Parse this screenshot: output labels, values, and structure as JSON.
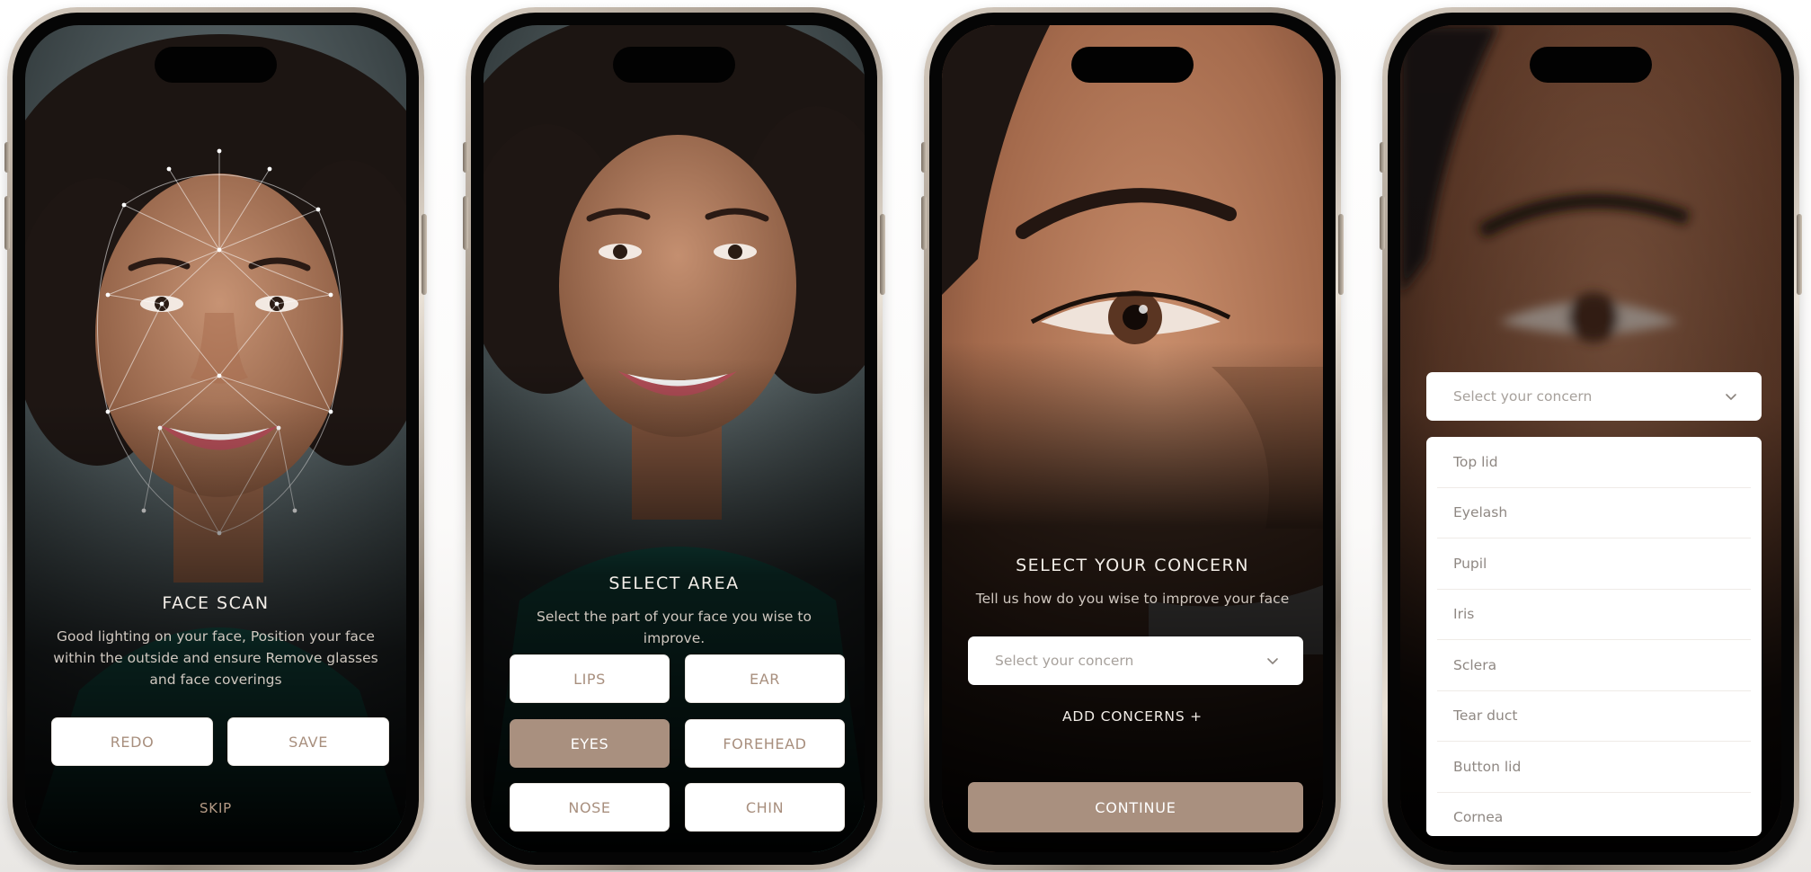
{
  "screens": {
    "face_scan": {
      "title": "FACE SCAN",
      "description": "Good lighting on your face, Position your face within the outside and ensure Remove glasses and face coverings",
      "redo_label": "REDO",
      "save_label": "SAVE",
      "skip_label": "SKIP"
    },
    "select_area": {
      "title": "SELECT AREA",
      "description": "Select the part of your face you wise to improve.",
      "areas": [
        {
          "label": "LIPS",
          "selected": false
        },
        {
          "label": "EAR",
          "selected": false
        },
        {
          "label": "EYES",
          "selected": true
        },
        {
          "label": "FOREHEAD",
          "selected": false
        },
        {
          "label": "NOSE",
          "selected": false
        },
        {
          "label": "CHIN",
          "selected": false
        }
      ]
    },
    "select_concern": {
      "title": "SELECT YOUR CONCERN",
      "description": "Tell us how do you wise to improve your face",
      "select_placeholder": "Select your concern",
      "add_concerns_label": "ADD CONCERNS +",
      "continue_label": "CONTINUE"
    },
    "concern_dropdown": {
      "select_placeholder": "Select your concern",
      "options": [
        "Top lid",
        "Eyelash",
        "Pupil",
        "Iris",
        "Sclera",
        "Tear duct",
        "Button lid",
        "Cornea"
      ]
    }
  },
  "icons": {
    "chevron": "chevron-down-icon"
  },
  "colors": {
    "accent": "#a9907f",
    "accent_text": "#a88f7e",
    "background": "#0a0a0a",
    "button_bg": "#ffffff"
  }
}
